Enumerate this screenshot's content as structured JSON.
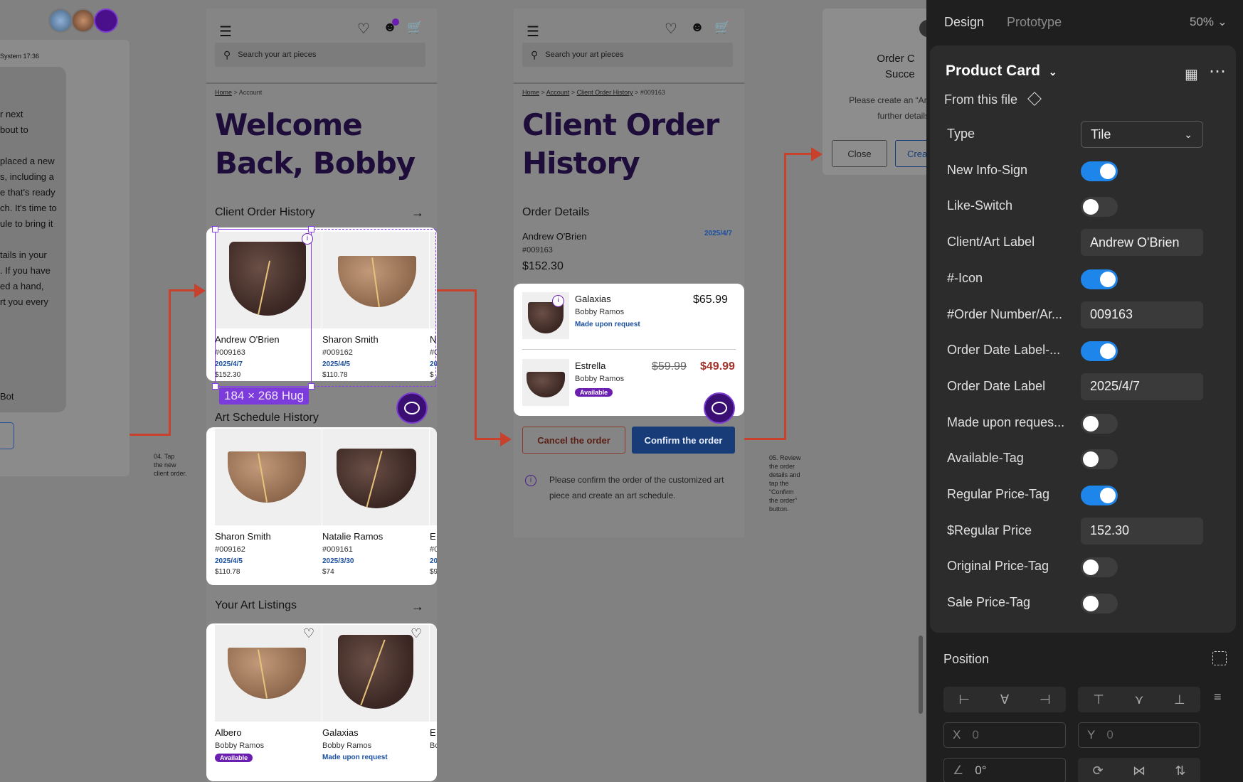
{
  "chat": {
    "time": "System 17:36",
    "lines": [
      "r next",
      "bout to",
      "placed a new",
      "s, including a",
      "e that's ready",
      "ch. It's time to",
      "ule to bring it",
      "tails in your",
      ". If you have",
      "ed a hand,",
      "rt you every"
    ],
    "bot": "Bot"
  },
  "notes": {
    "n4": [
      "04. Tap",
      "the new",
      "client order."
    ],
    "n5": [
      "05. Review",
      "the order",
      "details and",
      "tap the",
      "“Confirm",
      "the order”",
      "button."
    ]
  },
  "frame1": {
    "search_placeholder": "Search your art pieces",
    "crumb_home": "Home",
    "crumb_current": "Account",
    "title_line1": "Welcome",
    "title_line2": "Back, Bobby",
    "orders_title": "Client Order History",
    "orders": [
      {
        "name": "Andrew O'Brien",
        "num": "#009163",
        "date": "2025/4/7",
        "price": "$152.30"
      },
      {
        "name": "Sharon Smith",
        "num": "#009162",
        "date": "2025/4/5",
        "price": "$110.78"
      },
      {
        "name": "N",
        "num": "#0",
        "date": "20",
        "price": "$"
      }
    ],
    "hug_label": "184 × 268 Hug",
    "schedule_title": "Art Schedule History",
    "schedule": [
      {
        "name": "Sharon Smith",
        "num": "#009162",
        "date": "2025/4/5",
        "price": "$110.78"
      },
      {
        "name": "Natalie Ramos",
        "num": "#009161",
        "date": "2025/3/30",
        "price": "$74"
      },
      {
        "name": "E",
        "num": "#0",
        "date": "20",
        "price": "$9"
      }
    ],
    "listings_title": "Your Art Listings",
    "listings": [
      {
        "name": "Albero",
        "artist": "Bobby Ramos",
        "tag": "Available"
      },
      {
        "name": "Galaxias",
        "artist": "Bobby Ramos",
        "tag": "Made upon request"
      },
      {
        "name": "E",
        "artist": "Bo",
        "tag": ""
      }
    ]
  },
  "frame2": {
    "search_placeholder": "Search your art pieces",
    "crumbs": [
      "Home",
      "Account",
      "Client Order History",
      "#009163"
    ],
    "title_line1": "Client Order",
    "title_line2": "History",
    "details_title": "Order Details",
    "client": "Andrew O'Brien",
    "date": "2025/4/7",
    "num": "#009163",
    "total": "$152.30",
    "items": [
      {
        "name": "Galaxias",
        "artist": "Bobby Ramos",
        "tag": "Made upon request",
        "price": "$65.99"
      },
      {
        "name": "Estrella",
        "artist": "Bobby Ramos",
        "tag": "Available",
        "old_price": "$59.99",
        "price": "$49.99"
      }
    ],
    "cancel_label": "Cancel the order",
    "confirm_label": "Confirm the order",
    "info": "Please confirm the order of the customized art piece and create an art schedule."
  },
  "dialog": {
    "title1": "Order C",
    "title2": "Succe",
    "body1": "Please create an “Art",
    "body2": "further details",
    "close": "Close",
    "create": "Crea"
  },
  "panel": {
    "tabs": [
      "Design",
      "Prototype"
    ],
    "zoom": "50%",
    "component": "Product Card",
    "source": "From this file",
    "props": [
      {
        "label": "Type",
        "kind": "select",
        "value": "Tile"
      },
      {
        "label": "New Info-Sign",
        "kind": "toggle",
        "on": true
      },
      {
        "label": "Like-Switch",
        "kind": "toggle",
        "on": false
      },
      {
        "label": "Client/Art Label",
        "kind": "field",
        "value": "Andrew O'Brien"
      },
      {
        "label": "#-Icon",
        "kind": "toggle",
        "on": true
      },
      {
        "label": "#Order Number/Ar...",
        "kind": "field",
        "value": "009163"
      },
      {
        "label": "Order Date Label-...",
        "kind": "toggle",
        "on": true
      },
      {
        "label": "Order Date Label",
        "kind": "field",
        "value": "2025/4/7"
      },
      {
        "label": "Made upon reques...",
        "kind": "toggle",
        "on": false
      },
      {
        "label": "Available-Tag",
        "kind": "toggle",
        "on": false
      },
      {
        "label": "Regular Price-Tag",
        "kind": "toggle",
        "on": true
      },
      {
        "label": "$Regular Price",
        "kind": "field",
        "value": "152.30"
      },
      {
        "label": "Original Price-Tag",
        "kind": "toggle",
        "on": false
      },
      {
        "label": "Sale Price-Tag",
        "kind": "toggle",
        "on": false
      }
    ],
    "position_title": "Position",
    "x_label": "X",
    "x_value": "0",
    "y_label": "Y",
    "y_value": "0",
    "rotation": "0°"
  },
  "colors": {
    "accent": "#1e86ea",
    "brand_purple": "#6b1fb0",
    "connector": "#c8412c",
    "link_blue": "#1a4fa0"
  }
}
